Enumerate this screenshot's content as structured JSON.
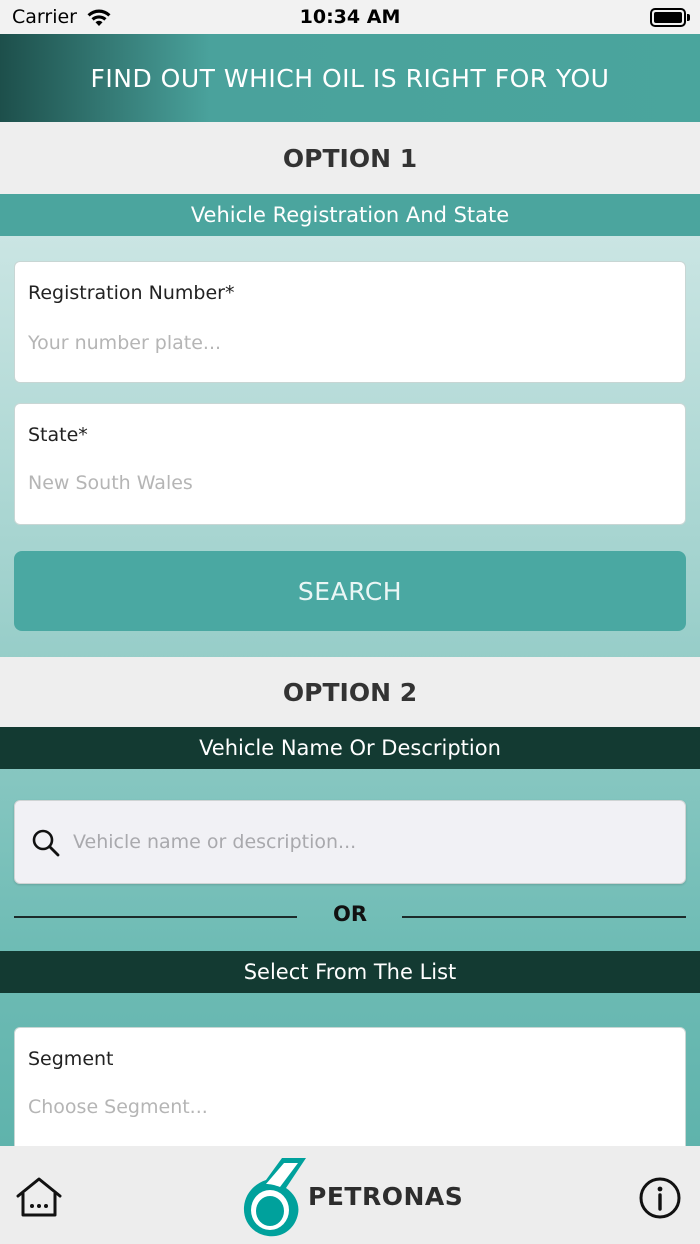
{
  "status_bar": {
    "carrier": "Carrier",
    "time": "10:34 AM"
  },
  "header": {
    "title": "FIND OUT WHICH OIL IS RIGHT FOR YOU"
  },
  "option1": {
    "label": "OPTION 1",
    "section_title": "Vehicle Registration And State",
    "registration": {
      "label": "Registration Number*",
      "placeholder": "Your number plate..."
    },
    "state": {
      "label": "State*",
      "value": "New South Wales"
    },
    "search_label": "SEARCH"
  },
  "option2": {
    "label": "OPTION 2",
    "section_title": "Vehicle Name Or Description",
    "search_placeholder": "Vehicle name or description...",
    "or_label": "OR",
    "list_title": "Select From The List",
    "segment": {
      "label": "Segment",
      "placeholder": "Choose Segment..."
    }
  },
  "bottom_bar": {
    "brand": "PETRONAS",
    "icons": [
      "home-icon",
      "info-icon"
    ]
  },
  "colors": {
    "header_teal": "#4aa59d",
    "button_teal": "#4aa8a2",
    "dark_band": "#133a32",
    "petronas_green": "#00a19c"
  }
}
